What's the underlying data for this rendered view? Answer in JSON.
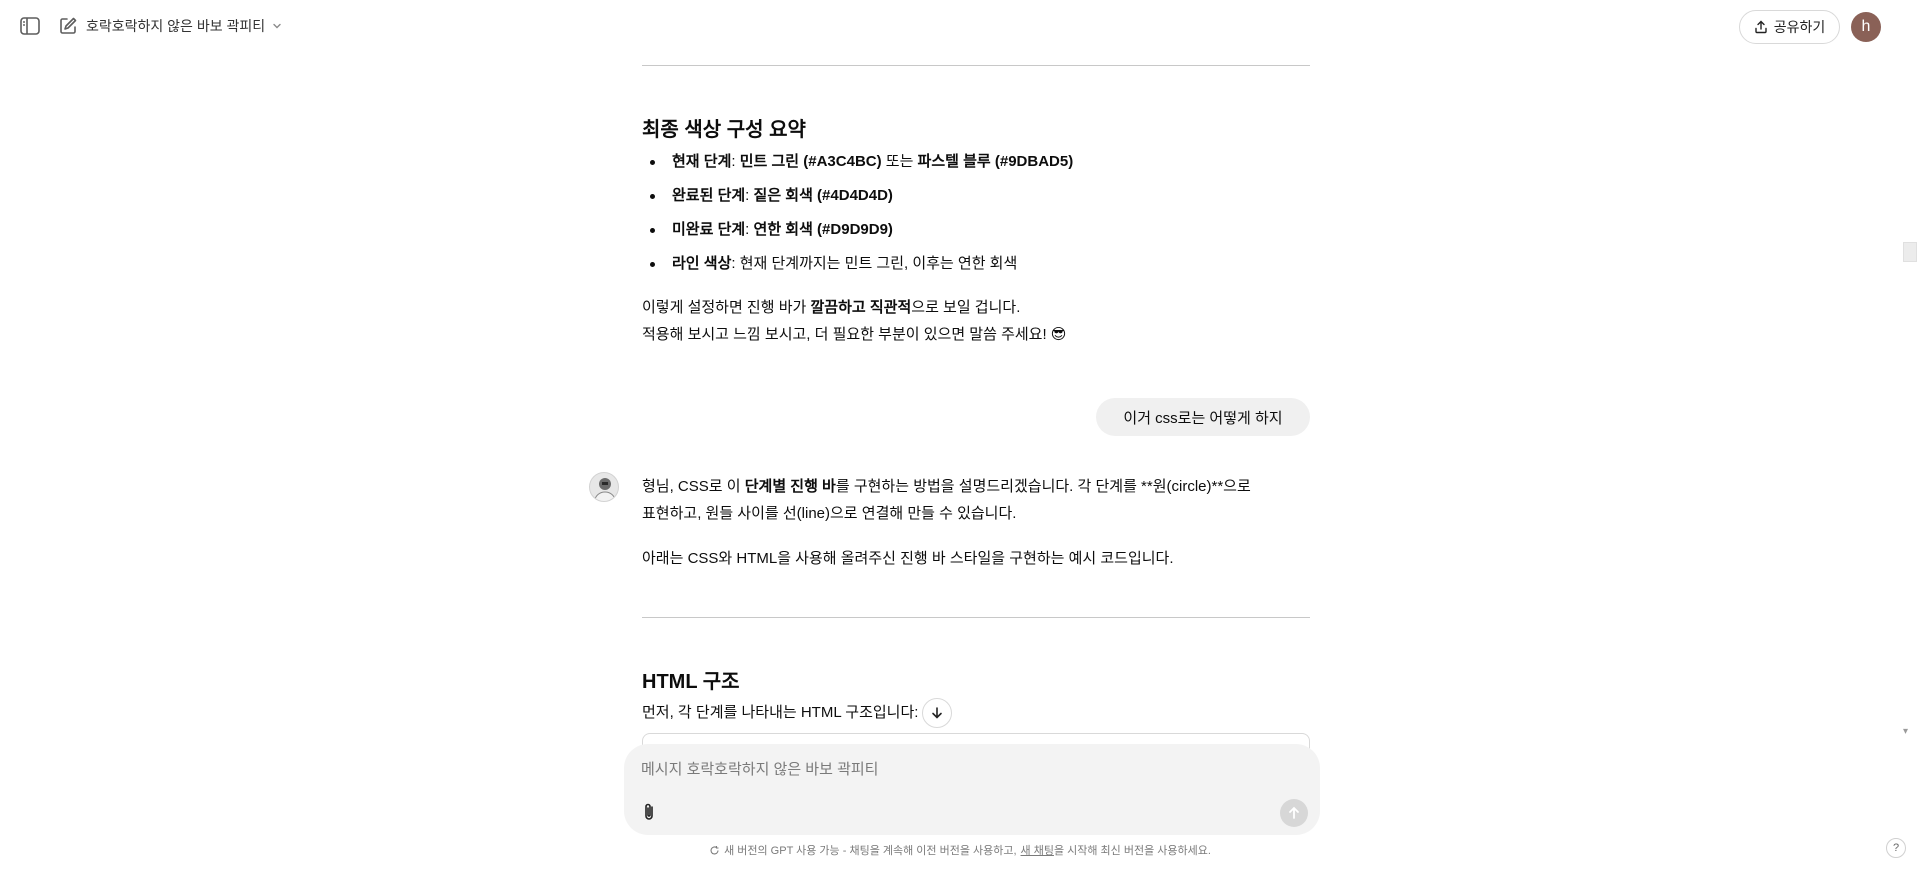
{
  "header": {
    "gpt_name": "호락호락하지 않은 바보 곽피티",
    "share_label": "공유하기",
    "avatar_initial": "h"
  },
  "summary": {
    "title": "최종 색상 구성 요약",
    "bullets": [
      {
        "label": "현재 단계",
        "sep": ": ",
        "text_bold": "민트 그린 (#A3C4BC)",
        "text": " 또는 ",
        "text_bold2": "파스텔 블루 (#9DBAD5)"
      },
      {
        "label": "완료된 단계",
        "sep": ": ",
        "text_bold": "짙은 회색 (#4D4D4D)"
      },
      {
        "label": "미완료 단계",
        "sep": ": ",
        "text_bold": "연한 회색 (#D9D9D9)"
      },
      {
        "label": "라인 색상",
        "text": ": 현재 단계까지는 민트 그린, 이후는 연한 회색"
      }
    ],
    "closing_1a": "이렇게 설정하면 진행 바가 ",
    "closing_1b": "깔끔하고 직관적",
    "closing_1c": "으로 보일 겁니다.",
    "closing_2": "적용해 보시고 느낌 보시고, 더 필요한 부분이 있으면 말씀 주세요! 😎"
  },
  "user_message": "이거 css로는 어떻게 하지",
  "assistant": {
    "p1a": "형님, CSS로 이 ",
    "p1b": "단계별 진행 바",
    "p1c": "를 구현하는 방법을 설명드리겠습니다. 각 단계를 **원(circle)**으로",
    "p1d": "표현하고, 원들 사이를 선(line)으로 연결해 만들 수 있습니다.",
    "p2": "아래는 CSS와 HTML을 사용해 올려주신 진행 바 스타일을 구현하는 예시 코드입니다.",
    "html_heading": "HTML 구조",
    "html_intro": "먼저, 각 단계를 나타내는 HTML 구조입니다:"
  },
  "composer": {
    "placeholder": "메시지 호락호락하지 않은 바보 곽피티"
  },
  "footer": {
    "note_a": "새 버전의 GPT 사용 가능 - 채팅을 계속해 이전 버전을 사용하고,",
    "note_link": "새 채팅",
    "note_b": "을 시작해 최신 버전을 사용하세요.",
    "help": "?"
  }
}
